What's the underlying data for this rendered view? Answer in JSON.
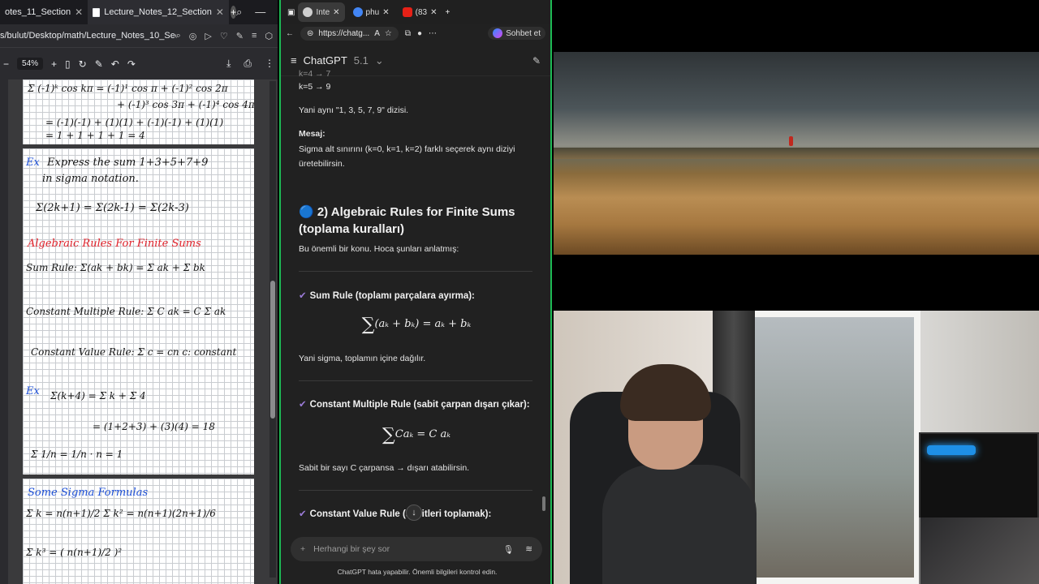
{
  "pdf": {
    "tabs": [
      {
        "label": "otes_11_Section"
      },
      {
        "label": "Lecture_Notes_12_Section"
      }
    ],
    "url": "s/bulut/Desktop/math/Lecture_Notes_10_Secti",
    "zoom": "54%",
    "page1": [
      "Σ (-1)ᵏ cos kπ = (-1)¹ cos π + (-1)² cos 2π",
      "+ (-1)³ cos 3π + (-1)⁴ cos 4π",
      "= (-1)(-1) + (1)(1) + (-1)(-1) + (1)(1)",
      "= 1 + 1 + 1 + 1 = 4"
    ],
    "page2": {
      "ex1_tag": "Ex",
      "ex1_line1": "Express the sum 1+3+5+7+9",
      "ex1_line2": "in sigma notation.",
      "ex1_answer": "Σ(2k+1) = Σ(2k-1) = Σ(2k-3)",
      "rules_title": "Algebraic Rules For Finite Sums",
      "sum_rule": "Sum Rule:  Σ(ak + bk) = Σ ak + Σ bk",
      "const_mult": "Constant Multiple Rule:  Σ C ak = C Σ ak",
      "const_value": "Constant Value Rule:  Σ c = cn   c: constant",
      "ex2_tag": "Ex",
      "ex2_line": "Σ(k+4) = Σ k + Σ 4",
      "ex2_result": "= (1+2+3) + (3)(4) = 18",
      "extra": "Σ 1/n = 1/n · n = 1"
    },
    "page3": {
      "title": "Some Sigma Formulas",
      "f1": "Σ k = n(n+1)/2     Σ k² = n(n+1)(2n+1)/6",
      "f2": "Σ k³ = ( n(n+1)/2 )²"
    }
  },
  "chat": {
    "tabs": [
      {
        "label": "Inte",
        "color": "#cfcfcf"
      },
      {
        "label": "phu",
        "color": "#4285f4"
      },
      {
        "label": "(83",
        "color": "#e62117"
      }
    ],
    "url": "https://chatg...",
    "sohbet": "Sohbet et",
    "model": "ChatGPT",
    "version": "5.1",
    "lines": {
      "k4": "k=4 → 7",
      "k5": "k=5 → 9",
      "same": "Yani aynı \"1, 3, 5, 7, 9\" dizisi.",
      "mesaj_label": "Mesaj:",
      "mesaj_text": "Sigma alt sınırını (k=0, k=1, k=2) farklı seçerek aynı diziyi üretebilirsin.",
      "section_title": "🔵 2) Algebraic Rules for Finite Sums (toplama kuralları)",
      "intro": "Bu önemli bir konu. Hoca şunları anlatmış:",
      "rule1_title": "Sum Rule (toplamı parçalara ayırma):",
      "rule1_formula": "(aₖ + bₖ) =   aₖ +   bₖ",
      "rule1_text": "Yani sigma, toplamın içine dağılır.",
      "rule2_title": "Constant Multiple Rule (sabit çarpan dışarı çıkar):",
      "rule2_formula": "Caₖ = C   aₖ",
      "rule2_text": "Sabit bir sayı C çarpansa → dışarı atabilirsin.",
      "rule3_title": "Constant Value Rule (sabitleri toplamak):"
    },
    "composer_placeholder": "Herhangi bir şey sor",
    "disclaimer": "ChatGPT hata yapabilir. Önemli bilgileri kontrol edin."
  }
}
